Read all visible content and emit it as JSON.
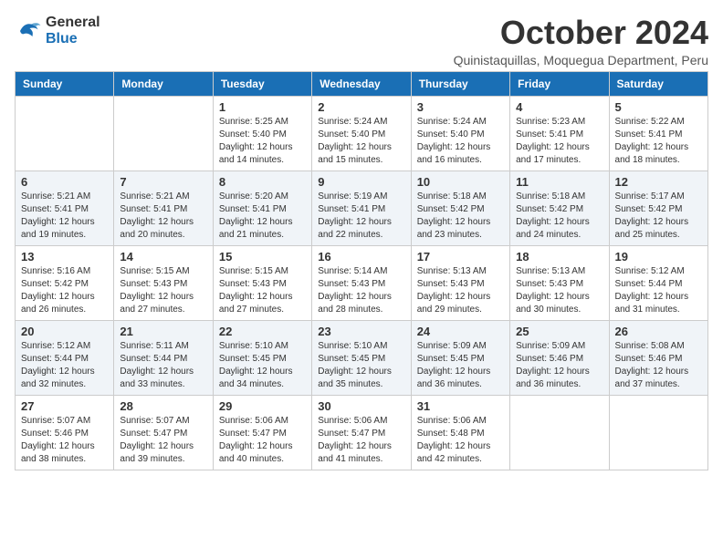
{
  "logo": {
    "line1": "General",
    "line2": "Blue"
  },
  "title": "October 2024",
  "location": "Quinistaquillas, Moquegua Department, Peru",
  "days_header": [
    "Sunday",
    "Monday",
    "Tuesday",
    "Wednesday",
    "Thursday",
    "Friday",
    "Saturday"
  ],
  "weeks": [
    [
      {
        "day": "",
        "sunrise": "",
        "sunset": "",
        "daylight": ""
      },
      {
        "day": "",
        "sunrise": "",
        "sunset": "",
        "daylight": ""
      },
      {
        "day": "1",
        "sunrise": "Sunrise: 5:25 AM",
        "sunset": "Sunset: 5:40 PM",
        "daylight": "Daylight: 12 hours and 14 minutes."
      },
      {
        "day": "2",
        "sunrise": "Sunrise: 5:24 AM",
        "sunset": "Sunset: 5:40 PM",
        "daylight": "Daylight: 12 hours and 15 minutes."
      },
      {
        "day": "3",
        "sunrise": "Sunrise: 5:24 AM",
        "sunset": "Sunset: 5:40 PM",
        "daylight": "Daylight: 12 hours and 16 minutes."
      },
      {
        "day": "4",
        "sunrise": "Sunrise: 5:23 AM",
        "sunset": "Sunset: 5:41 PM",
        "daylight": "Daylight: 12 hours and 17 minutes."
      },
      {
        "day": "5",
        "sunrise": "Sunrise: 5:22 AM",
        "sunset": "Sunset: 5:41 PM",
        "daylight": "Daylight: 12 hours and 18 minutes."
      }
    ],
    [
      {
        "day": "6",
        "sunrise": "Sunrise: 5:21 AM",
        "sunset": "Sunset: 5:41 PM",
        "daylight": "Daylight: 12 hours and 19 minutes."
      },
      {
        "day": "7",
        "sunrise": "Sunrise: 5:21 AM",
        "sunset": "Sunset: 5:41 PM",
        "daylight": "Daylight: 12 hours and 20 minutes."
      },
      {
        "day": "8",
        "sunrise": "Sunrise: 5:20 AM",
        "sunset": "Sunset: 5:41 PM",
        "daylight": "Daylight: 12 hours and 21 minutes."
      },
      {
        "day": "9",
        "sunrise": "Sunrise: 5:19 AM",
        "sunset": "Sunset: 5:41 PM",
        "daylight": "Daylight: 12 hours and 22 minutes."
      },
      {
        "day": "10",
        "sunrise": "Sunrise: 5:18 AM",
        "sunset": "Sunset: 5:42 PM",
        "daylight": "Daylight: 12 hours and 23 minutes."
      },
      {
        "day": "11",
        "sunrise": "Sunrise: 5:18 AM",
        "sunset": "Sunset: 5:42 PM",
        "daylight": "Daylight: 12 hours and 24 minutes."
      },
      {
        "day": "12",
        "sunrise": "Sunrise: 5:17 AM",
        "sunset": "Sunset: 5:42 PM",
        "daylight": "Daylight: 12 hours and 25 minutes."
      }
    ],
    [
      {
        "day": "13",
        "sunrise": "Sunrise: 5:16 AM",
        "sunset": "Sunset: 5:42 PM",
        "daylight": "Daylight: 12 hours and 26 minutes."
      },
      {
        "day": "14",
        "sunrise": "Sunrise: 5:15 AM",
        "sunset": "Sunset: 5:43 PM",
        "daylight": "Daylight: 12 hours and 27 minutes."
      },
      {
        "day": "15",
        "sunrise": "Sunrise: 5:15 AM",
        "sunset": "Sunset: 5:43 PM",
        "daylight": "Daylight: 12 hours and 27 minutes."
      },
      {
        "day": "16",
        "sunrise": "Sunrise: 5:14 AM",
        "sunset": "Sunset: 5:43 PM",
        "daylight": "Daylight: 12 hours and 28 minutes."
      },
      {
        "day": "17",
        "sunrise": "Sunrise: 5:13 AM",
        "sunset": "Sunset: 5:43 PM",
        "daylight": "Daylight: 12 hours and 29 minutes."
      },
      {
        "day": "18",
        "sunrise": "Sunrise: 5:13 AM",
        "sunset": "Sunset: 5:43 PM",
        "daylight": "Daylight: 12 hours and 30 minutes."
      },
      {
        "day": "19",
        "sunrise": "Sunrise: 5:12 AM",
        "sunset": "Sunset: 5:44 PM",
        "daylight": "Daylight: 12 hours and 31 minutes."
      }
    ],
    [
      {
        "day": "20",
        "sunrise": "Sunrise: 5:12 AM",
        "sunset": "Sunset: 5:44 PM",
        "daylight": "Daylight: 12 hours and 32 minutes."
      },
      {
        "day": "21",
        "sunrise": "Sunrise: 5:11 AM",
        "sunset": "Sunset: 5:44 PM",
        "daylight": "Daylight: 12 hours and 33 minutes."
      },
      {
        "day": "22",
        "sunrise": "Sunrise: 5:10 AM",
        "sunset": "Sunset: 5:45 PM",
        "daylight": "Daylight: 12 hours and 34 minutes."
      },
      {
        "day": "23",
        "sunrise": "Sunrise: 5:10 AM",
        "sunset": "Sunset: 5:45 PM",
        "daylight": "Daylight: 12 hours and 35 minutes."
      },
      {
        "day": "24",
        "sunrise": "Sunrise: 5:09 AM",
        "sunset": "Sunset: 5:45 PM",
        "daylight": "Daylight: 12 hours and 36 minutes."
      },
      {
        "day": "25",
        "sunrise": "Sunrise: 5:09 AM",
        "sunset": "Sunset: 5:46 PM",
        "daylight": "Daylight: 12 hours and 36 minutes."
      },
      {
        "day": "26",
        "sunrise": "Sunrise: 5:08 AM",
        "sunset": "Sunset: 5:46 PM",
        "daylight": "Daylight: 12 hours and 37 minutes."
      }
    ],
    [
      {
        "day": "27",
        "sunrise": "Sunrise: 5:07 AM",
        "sunset": "Sunset: 5:46 PM",
        "daylight": "Daylight: 12 hours and 38 minutes."
      },
      {
        "day": "28",
        "sunrise": "Sunrise: 5:07 AM",
        "sunset": "Sunset: 5:47 PM",
        "daylight": "Daylight: 12 hours and 39 minutes."
      },
      {
        "day": "29",
        "sunrise": "Sunrise: 5:06 AM",
        "sunset": "Sunset: 5:47 PM",
        "daylight": "Daylight: 12 hours and 40 minutes."
      },
      {
        "day": "30",
        "sunrise": "Sunrise: 5:06 AM",
        "sunset": "Sunset: 5:47 PM",
        "daylight": "Daylight: 12 hours and 41 minutes."
      },
      {
        "day": "31",
        "sunrise": "Sunrise: 5:06 AM",
        "sunset": "Sunset: 5:48 PM",
        "daylight": "Daylight: 12 hours and 42 minutes."
      },
      {
        "day": "",
        "sunrise": "",
        "sunset": "",
        "daylight": ""
      },
      {
        "day": "",
        "sunrise": "",
        "sunset": "",
        "daylight": ""
      }
    ]
  ]
}
